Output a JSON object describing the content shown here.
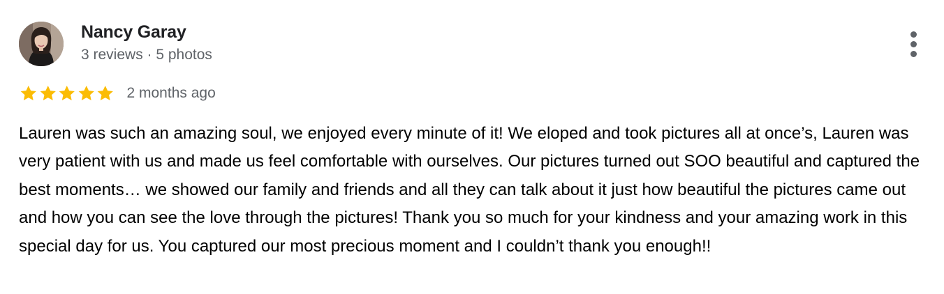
{
  "reviewer": {
    "name": "Nancy Garay",
    "meta": "3 reviews · 5 photos"
  },
  "rating": {
    "stars": 5,
    "max_stars": 5,
    "star_color": "#fbbc04",
    "time": "2 months ago"
  },
  "review": {
    "text": "Lauren was such an amazing soul, we enjoyed every minute of it! We eloped and took pictures all at once’s, Lauren was very patient with us and made us feel comfortable with ourselves. Our pictures turned out SOO beautiful and captured the best moments… we showed our family and friends and all they can talk about it just how beautiful the pictures came out and how you can see the love through the pictures! Thank you so much for your kindness and your amazing work in this special day for us. You captured our most precious moment and I couldn’t thank you enough!!"
  },
  "icons": {
    "more": "more-vert-icon",
    "star": "star-icon",
    "avatar": "profile-photo"
  }
}
